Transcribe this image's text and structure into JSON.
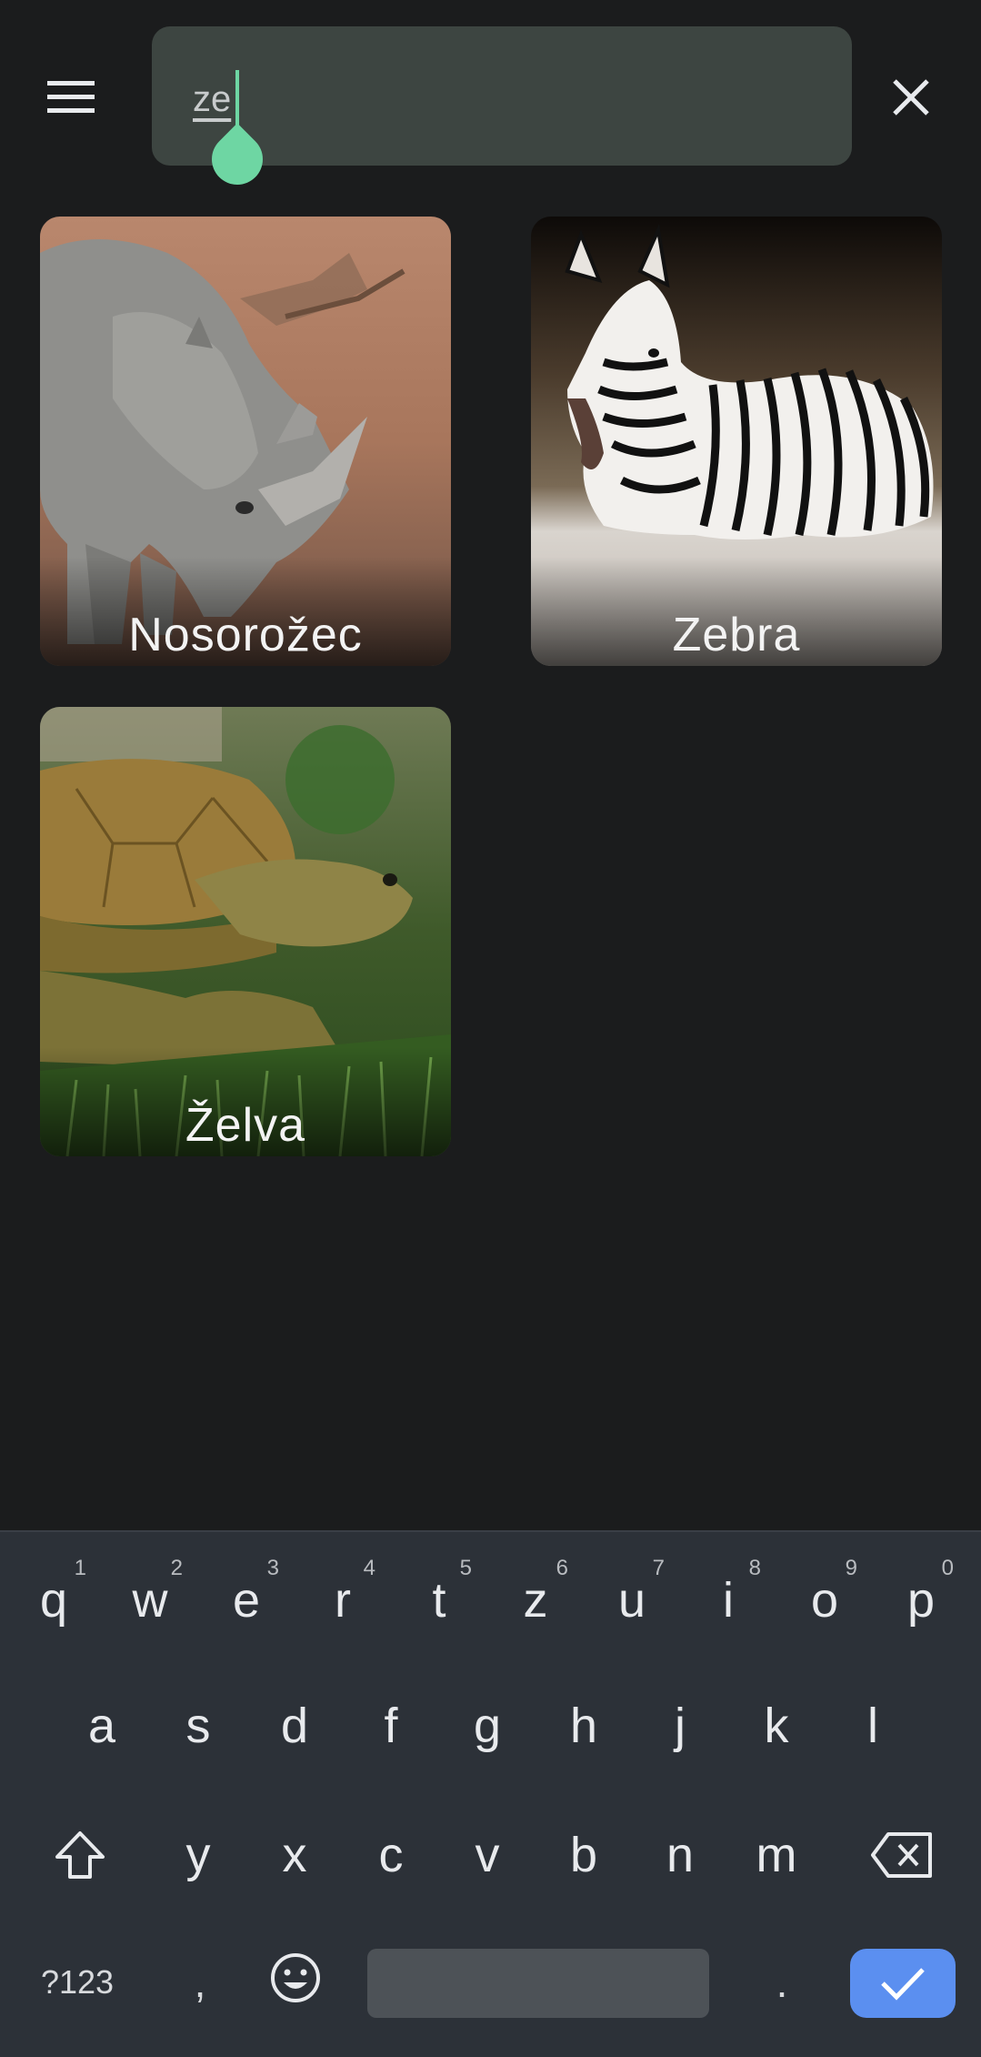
{
  "search": {
    "value": "ze"
  },
  "icons": {
    "menu": "menu-icon",
    "close": "close-icon",
    "shift": "shift-icon",
    "backspace": "backspace-icon",
    "emoji": "emoji-icon",
    "enter": "check-icon"
  },
  "results": [
    {
      "label": "Nosorožec"
    },
    {
      "label": "Zebra"
    },
    {
      "label": "Želva"
    }
  ],
  "keyboard": {
    "row1": [
      {
        "key": "q",
        "hint": "1"
      },
      {
        "key": "w",
        "hint": "2"
      },
      {
        "key": "e",
        "hint": "3"
      },
      {
        "key": "r",
        "hint": "4"
      },
      {
        "key": "t",
        "hint": "5"
      },
      {
        "key": "z",
        "hint": "6"
      },
      {
        "key": "u",
        "hint": "7"
      },
      {
        "key": "i",
        "hint": "8"
      },
      {
        "key": "o",
        "hint": "9"
      },
      {
        "key": "p",
        "hint": "0"
      }
    ],
    "row2": [
      "a",
      "s",
      "d",
      "f",
      "g",
      "h",
      "j",
      "k",
      "l"
    ],
    "row3": [
      "y",
      "x",
      "c",
      "v",
      "b",
      "n",
      "m"
    ],
    "symbols_label": "?123",
    "comma": ",",
    "period": "."
  },
  "colors": {
    "accent": "#6ed6a3",
    "enter_key": "#5b8ff0",
    "search_bg": "#3d4541",
    "background": "#1b1c1d"
  }
}
